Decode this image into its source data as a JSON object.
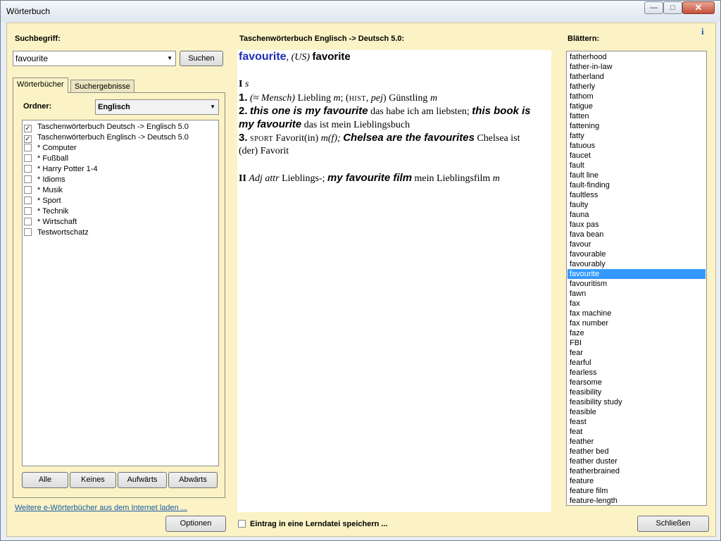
{
  "window": {
    "title": "Wörterbuch",
    "min": "—",
    "max": "□",
    "close": "✕"
  },
  "search": {
    "label": "Suchbegriff:",
    "value": "favourite",
    "button": "Suchen"
  },
  "tabs": [
    "Wörterbücher",
    "Suchergebnisse"
  ],
  "folder": {
    "label": "Ordner:",
    "value": "Englisch"
  },
  "dictionaries": [
    {
      "label": "Taschenwörterbuch Deutsch -> Englisch 5.0",
      "checked": true
    },
    {
      "label": "Taschenwörterbuch Englisch -> Deutsch 5.0",
      "checked": true
    },
    {
      "label": "* Computer",
      "checked": false
    },
    {
      "label": "* Fußball",
      "checked": false
    },
    {
      "label": "* Harry Potter 1-4",
      "checked": false
    },
    {
      "label": "* Idioms",
      "checked": false
    },
    {
      "label": "* Musik",
      "checked": false
    },
    {
      "label": "* Sport",
      "checked": false
    },
    {
      "label": "* Technik",
      "checked": false
    },
    {
      "label": "* Wirtschaft",
      "checked": false
    },
    {
      "label": "Testwortschatz",
      "checked": false
    }
  ],
  "dict_buttons": {
    "all": "Alle",
    "none": "Keines",
    "up": "Aufwärts",
    "down": "Abwärts"
  },
  "more_link": "Weitere e-Wörterbücher aus dem Internet laden ...",
  "options_button": "Optionen",
  "result": {
    "heading": "Taschenwörterbuch Englisch -> Deutsch 5.0:",
    "headword": "favourite",
    "variant_label": "(US)",
    "variant": "favorite",
    "sec1_roman": "I",
    "sec1_pos": "s",
    "s1_num": "1.",
    "s1_label": "(≈ Mensch)",
    "s1_trans": "Liebling",
    "s1_gender": "m",
    "s1_label2": "HIST",
    "s1_label3": "pej",
    "s1_trans2": "Günstling",
    "s1_gender2": "m",
    "s2_num": "2.",
    "s2_ex1": "this one is my favourite",
    "s2_tr1": "das habe ich am liebsten;",
    "s2_ex2a": "this book is",
    "s2_ex2b": "my favourite",
    "s2_tr2": "das ist mein Lieblingsbuch",
    "s3_num": "3.",
    "s3_label": "SPORT",
    "s3_trans": "Favorit(in)",
    "s3_gender": "m(f);",
    "s3_ex": "Chelsea are the favourites",
    "s3_tr_a": "Chelsea ist",
    "s3_tr_b": "(der) Favorit",
    "sec2_roman": "II",
    "sec2_pos": "Adj attr",
    "sec2_trans": "Lieblings-;",
    "sec2_ex": "my favourite film",
    "sec2_tr": "mein Lieblingsfilm",
    "sec2_gender": "m"
  },
  "save_checkbox": "Eintrag in eine Lerndatei speichern ...",
  "browse": {
    "label": "Blättern:",
    "items": [
      "fatherhood",
      "father-in-law",
      "fatherland",
      "fatherly",
      "fathom",
      "fatigue",
      "fatten",
      "fattening",
      "fatty",
      "fatuous",
      "faucet",
      "fault",
      "fault line",
      "fault-finding",
      "faultless",
      "faulty",
      "fauna",
      "faux pas",
      "fava bean",
      "favour",
      "favourable",
      "favourably",
      "favourite",
      "favouritism",
      "fawn",
      "fax",
      "fax machine",
      "fax number",
      "faze",
      "FBI",
      "fear",
      "fearful",
      "fearless",
      "fearsome",
      "feasibility",
      "feasibility study",
      "feasible",
      "feast",
      "feat",
      "feather",
      "feather bed",
      "feather duster",
      "featherbrained",
      "feature",
      "feature film",
      "feature-length"
    ],
    "selected_index": 22
  },
  "close_button": "Schließen",
  "info_icon": "i"
}
